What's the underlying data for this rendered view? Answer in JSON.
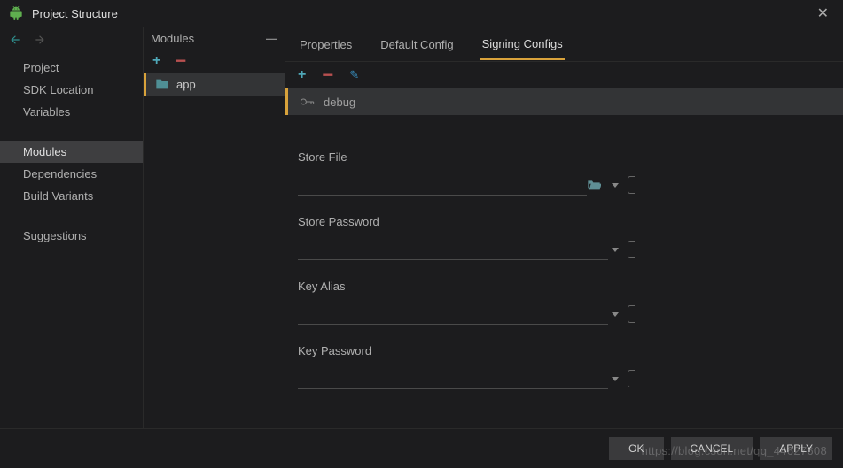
{
  "window": {
    "title": "Project Structure"
  },
  "sidebar": {
    "items": [
      {
        "label": "Project"
      },
      {
        "label": "SDK Location"
      },
      {
        "label": "Variables"
      },
      {
        "label": "Modules"
      },
      {
        "label": "Dependencies"
      },
      {
        "label": "Build Variants"
      },
      {
        "label": "Suggestions"
      }
    ]
  },
  "modules": {
    "header": "Modules",
    "selected": "app"
  },
  "tabs": [
    {
      "label": "Properties"
    },
    {
      "label": "Default Config"
    },
    {
      "label": "Signing Configs"
    }
  ],
  "configs": {
    "selected": "debug"
  },
  "form": {
    "storeFile": {
      "label": "Store File",
      "value": ""
    },
    "storePassword": {
      "label": "Store Password",
      "value": ""
    },
    "keyAlias": {
      "label": "Key Alias",
      "value": ""
    },
    "keyPassword": {
      "label": "Key Password",
      "value": ""
    }
  },
  "buttons": {
    "ok": "OK",
    "cancel": "CANCEL",
    "apply": "APPLY"
  },
  "watermark": "https://blog.csdn.net/qq_44627608"
}
